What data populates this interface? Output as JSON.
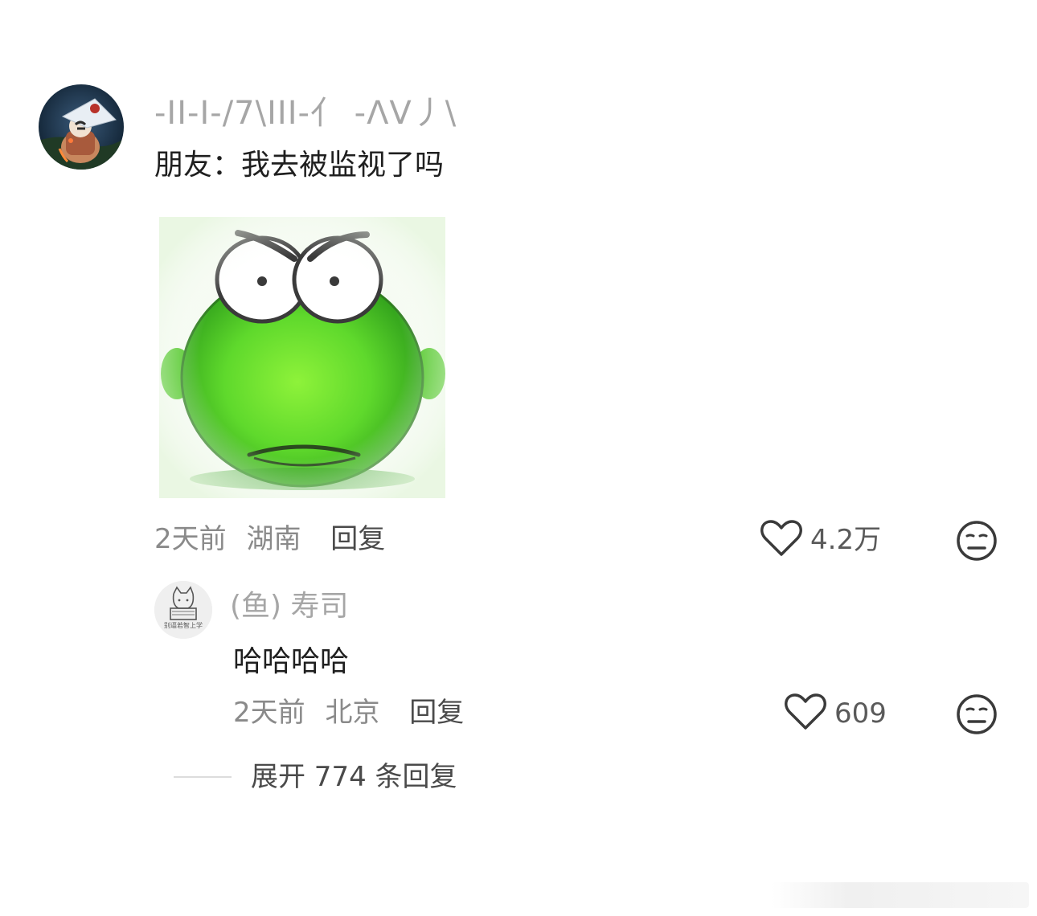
{
  "comment": {
    "username": "-II-I-/7\\III-亻 -ΛV丿\\",
    "text": "朋友：我去被监视了吗",
    "time": "2天前",
    "location": "湖南",
    "reply_label": "回复",
    "like_count": "4.2万",
    "sticker": "green-frog-sticker"
  },
  "reply": {
    "username": "(鱼) 寿司",
    "avatar_caption": "别逼若智上学",
    "text": "哈哈哈哈",
    "time": "2天前",
    "location": "北京",
    "reply_label": "回复",
    "like_count": "609"
  },
  "expand": {
    "label": "展开 774 条回复"
  },
  "colors": {
    "primary_text": "#1f1f1f",
    "secondary_text": "#8a8a8a",
    "username": "#a6a6a6",
    "icon": "#3a3a3a",
    "sticker_green": "#5fd92c"
  },
  "icons": {
    "like": "heart-outline-icon",
    "dislike": "meh-face-icon"
  }
}
